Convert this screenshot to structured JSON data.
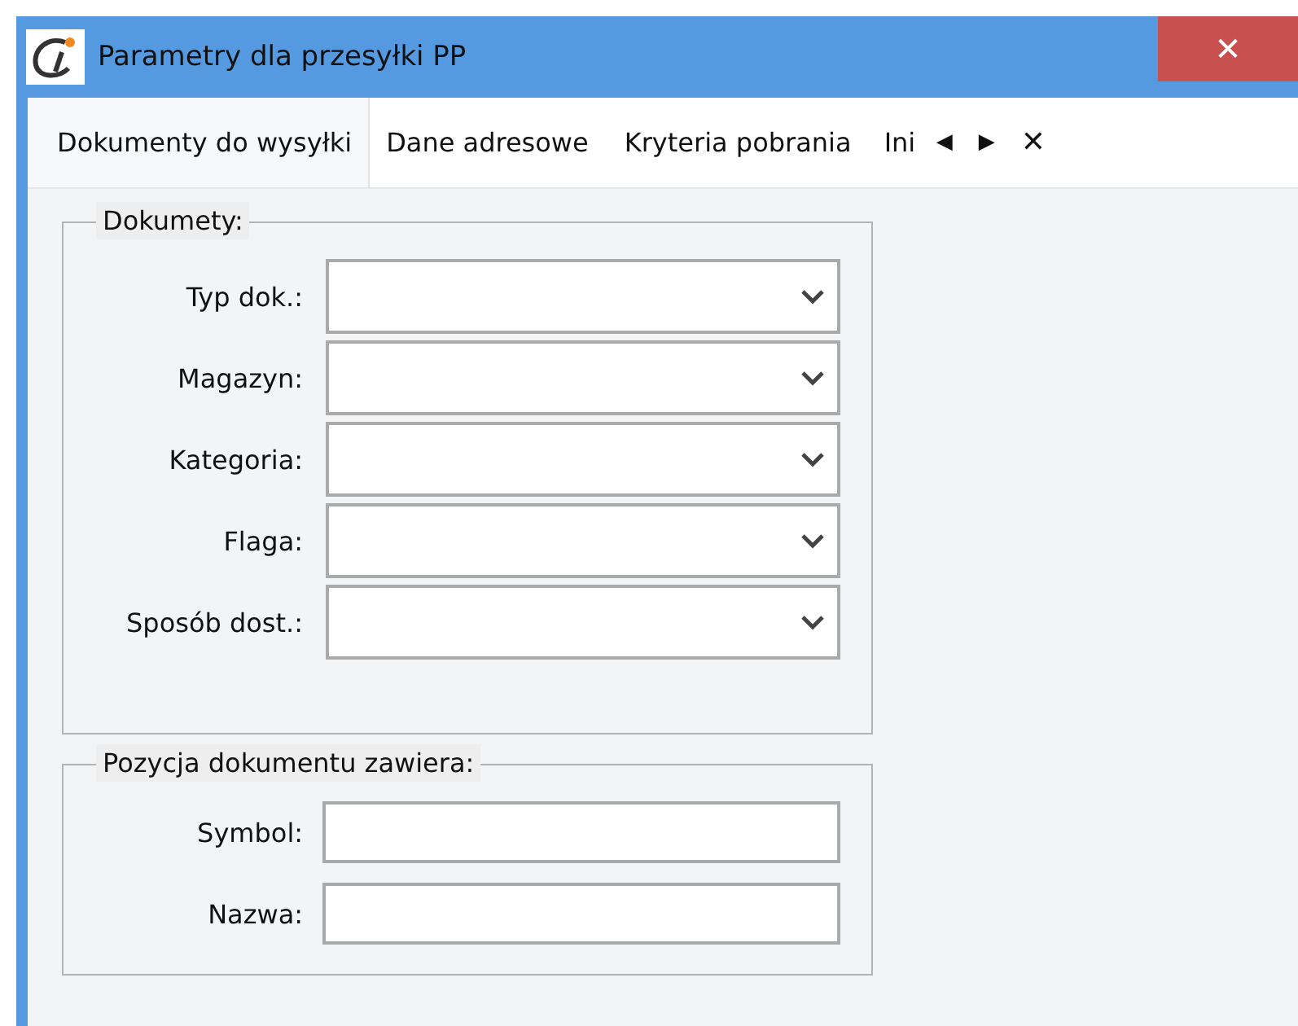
{
  "window": {
    "title": "Parametry dla przesyłki PP",
    "close": "✕"
  },
  "tabs": [
    {
      "label": "Dokumenty do wysyłki",
      "selected": true
    },
    {
      "label": "Dane adresowe",
      "selected": false
    },
    {
      "label": "Kryteria pobrania",
      "selected": false
    },
    {
      "label": "Ini",
      "selected": false
    }
  ],
  "tab_nav": {
    "prev": "◀",
    "next": "▶",
    "close": "✕"
  },
  "groups": [
    {
      "title": "Dokumety:",
      "fields": [
        {
          "label": "Typ dok.:",
          "kind": "combo"
        },
        {
          "label": "Magazyn:",
          "kind": "combo"
        },
        {
          "label": "Kategoria:",
          "kind": "combo"
        },
        {
          "label": "Flaga:",
          "kind": "combo"
        },
        {
          "label": "Sposób dost.:",
          "kind": "combo"
        }
      ]
    },
    {
      "title": "Pozycja dokumentu zawiera:",
      "fields": [
        {
          "label": "Symbol:",
          "kind": "text"
        },
        {
          "label": "Nazwa:",
          "kind": "text"
        }
      ]
    }
  ]
}
